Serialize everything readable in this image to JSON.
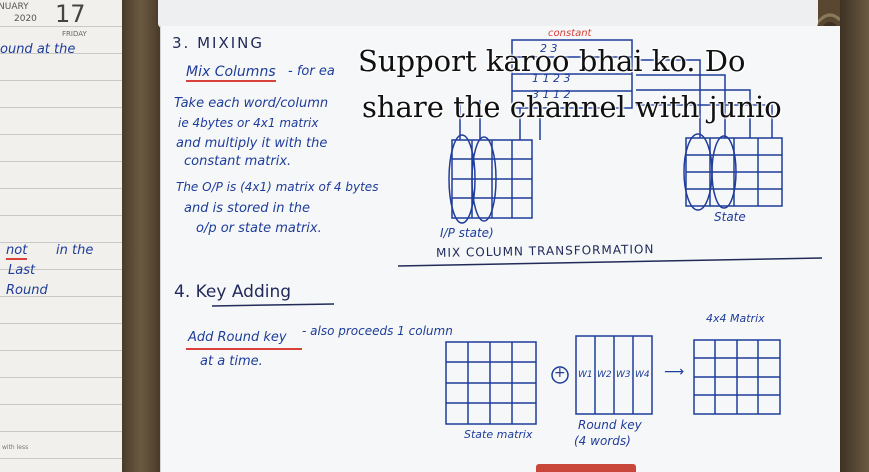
{
  "planner": {
    "month": "NUARY",
    "year": "2020",
    "day_number": "17",
    "weekday": "FRIDAY",
    "line1": "ound at the",
    "note_word1": "not",
    "note_word2": "in the",
    "note_word3": "Last",
    "note_word4": "Round",
    "footer": "with less"
  },
  "notes": {
    "section3_heading": "3. MIXING",
    "mix_columns_title": "Mix Columns",
    "mix_columns_suffix": "- for ea",
    "para_line1": "Take each word/column",
    "para_line2": "ie 4bytes or 4x1 matrix",
    "para_line3": "and multiply it with the",
    "para_line4": "constant matrix.",
    "para_line5": "The O/P is (4x1) matrix of 4 bytes",
    "para_line6": "and is stored in the",
    "para_line7": "o/p or state matrix.",
    "constant_label": "constant",
    "constant_row1": "2 3",
    "constant_row2": "1 1 2 3",
    "constant_row3": "3 1 1 2",
    "ip_state_label": "I/P state)",
    "state_label": "State",
    "mix_column_caption": "MIX COLUMN TRANSFORMATION",
    "section4_heading": "4.  Key Adding",
    "add_round_key_title": "Add Round key",
    "add_round_key_line1": "- also proceeds 1 column",
    "add_round_key_line2": "at a time.",
    "plus_symbol": "+",
    "w1": "W1",
    "w2": "W2",
    "w3": "W3",
    "w4": "W4",
    "arrow": "⟶",
    "matrix_4x4_label": "4x4 Matrix",
    "state_matrix_label": "State matrix",
    "round_key_label": "Round key",
    "round_key_sub": "(4 words)"
  },
  "overlay": {
    "line1": "Support karoo bhai ko. Do",
    "line2": "share the channel with junio"
  },
  "colors": {
    "ink": "#1f3d9a",
    "underline": "#d9413a",
    "paper": "#f6f7f8",
    "background": "#5b4a36"
  }
}
